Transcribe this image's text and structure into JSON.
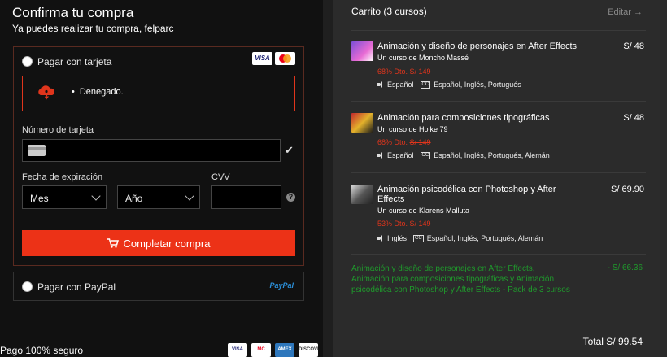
{
  "checkout": {
    "title": "Confirma tu compra",
    "subtitle": "Ya puedes realizar tu compra, felparc",
    "card_option_label": "Pagar con tarjeta",
    "card_brands": [
      "VISA",
      "mastercard"
    ],
    "error_message": "Denegado.",
    "card_number_label": "Número de tarjeta",
    "card_number_value": "",
    "expiry_label": "Fecha de expiración",
    "month_select": "Mes",
    "year_select": "Año",
    "cvv_label": "CVV",
    "cvv_value": "",
    "submit_label": "Completar compra",
    "paypal_option_label": "Pagar con PayPal",
    "paypal_logo": "PayPal",
    "secure_label": "Pago 100% seguro",
    "secure_badges": [
      "VISA",
      "MC",
      "AMEX",
      "DISCOVER"
    ]
  },
  "cart": {
    "title": "Carrito (3 cursos)",
    "edit_label": "Editar →",
    "items": [
      {
        "title": "Animación y diseño de personajes en After Effects",
        "author": "Un curso de Moncho Massé",
        "price": "S/ 48",
        "discount": "68% Dto.",
        "old_price": "S/ 149",
        "audio": "Español",
        "subtitles": "Español, Inglés, Portugués"
      },
      {
        "title": "Animación para composiciones tipográficas",
        "author": "Un curso de Holke 79",
        "price": "S/ 48",
        "discount": "68% Dto.",
        "old_price": "S/ 149",
        "audio": "Español",
        "subtitles": "Español, Inglés, Portugués, Alemán"
      },
      {
        "title": "Animación psicodélica con Photoshop y After Effects",
        "author": "Un curso de Klarens Malluta",
        "price": "S/ 69.90",
        "discount": "53% Dto.",
        "old_price": "S/ 149",
        "audio": "Inglés",
        "subtitles": "Español, Inglés, Portugués, Alemán"
      }
    ],
    "bundle_text": "Animación y diseño de personajes en After Effects, Animación para composiciones tipográficas y Animación psicodélica con Photoshop y After Effects - Pack de 3 cursos",
    "bundle_discount": "- S/ 66.36",
    "total": "Total S/ 99.54"
  },
  "colors": {
    "accent": "#ec3217",
    "discount_green": "#1f9a2c",
    "error_red": "#e0351c"
  }
}
